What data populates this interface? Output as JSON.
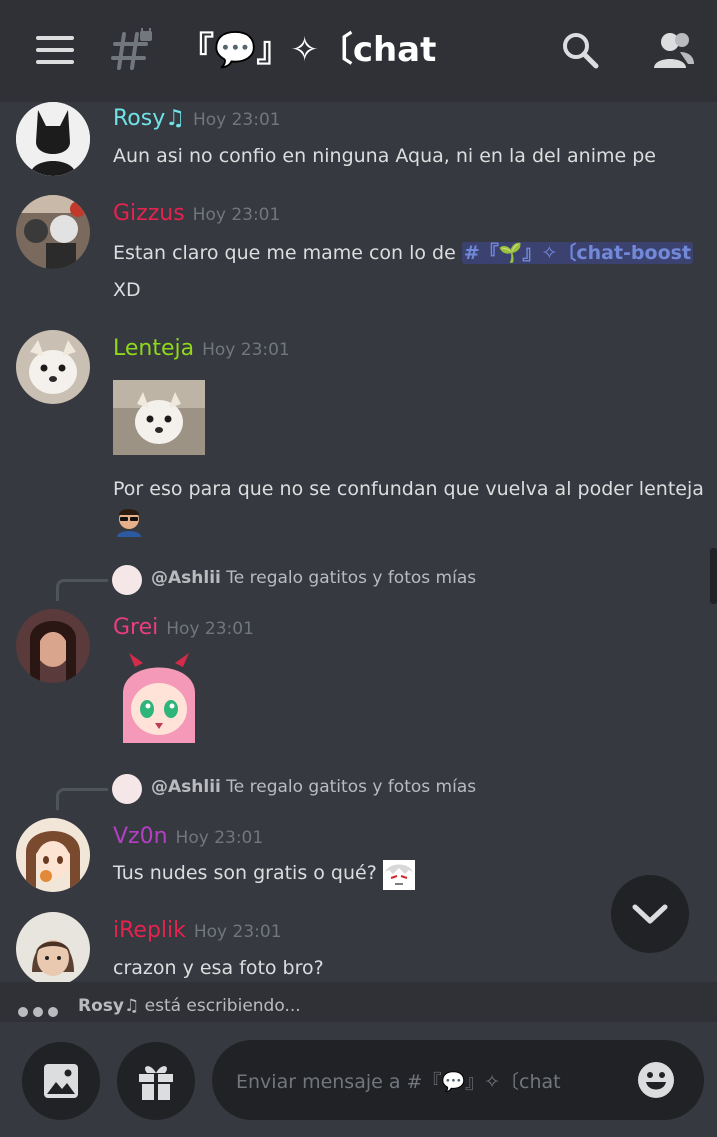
{
  "header": {
    "channel_title": "『💬』✧〔chat",
    "icons": [
      "menu-icon",
      "hash-lock-icon",
      "search-icon",
      "members-icon"
    ]
  },
  "messages": [
    {
      "user": "Rosy♫",
      "user_color": "#6fe3e8",
      "time": "Hoy 23:01",
      "text": "Aun asi no confio en ninguna Aqua, ni en la del anime pe"
    },
    {
      "user": "Gizzus",
      "user_color": "#e6224f",
      "time": "Hoy 23:01",
      "text_before": "Estan claro que me mame con lo de ",
      "mention": "#『🌱』✧〔chat-boost",
      "text2": "XD"
    },
    {
      "user": "Lenteja",
      "user_color": "#8fd81b",
      "time": "Hoy 23:01",
      "text": "Por eso para que no se confundan que vuelva al poder lenteja"
    },
    {
      "reply_user": "@Ashlii",
      "reply_text": "Te regalo gatitos y fotos mías",
      "user": "Grei",
      "user_color": "#e93d84",
      "time": "Hoy 23:01"
    },
    {
      "reply_user": "@Ashlii",
      "reply_text": "Te regalo gatitos y fotos mías",
      "user": "Vz0n",
      "user_color": "#b53fc4",
      "time": "Hoy 23:01",
      "text": "Tus nudes son gratis o qué?"
    },
    {
      "user": "iReplik",
      "user_color": "#e6224f",
      "time": "Hoy 23:01",
      "text": "crazon y esa foto bro?"
    }
  ],
  "typing": {
    "user": "Rosy♫",
    "suffix": " está escribiendo..."
  },
  "composer": {
    "placeholder": "Enviar mensaje a #『💬』✧〔chat"
  },
  "colors": {
    "background": "#36393f",
    "header": "#2f3136",
    "mention_bg": "#3c4270",
    "mention_fg": "#7289da"
  }
}
